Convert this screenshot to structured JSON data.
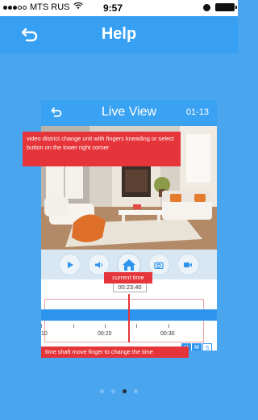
{
  "status_bar": {
    "carrier": "MTS RUS",
    "time": "9:57"
  },
  "nav": {
    "title": "Help",
    "back_icon": "back-arrow-icon"
  },
  "help_image": {
    "nav_title": "Live View",
    "date": "01-13",
    "video_tip": "video district change unit with fingers kneading or select button on the lower right corner",
    "controls": [
      {
        "name": "play-icon"
      },
      {
        "name": "volume-icon"
      },
      {
        "name": "home-icon"
      },
      {
        "name": "camera-icon"
      },
      {
        "name": "record-icon"
      }
    ],
    "current_time_label": "current time",
    "current_time_value": "00:23:40",
    "ticks": [
      "10",
      "00:20",
      "00:30"
    ],
    "timeline_tip": "time shaft move finger to change the time",
    "hms": [
      "H",
      "M",
      "S"
    ]
  },
  "pager": {
    "count": 4,
    "active_index": 2
  },
  "colors": {
    "background": "#4aa5ef",
    "nav": "#37a0f2",
    "accent_red": "#e5353a",
    "timeline_blue": "#2e95ef"
  }
}
